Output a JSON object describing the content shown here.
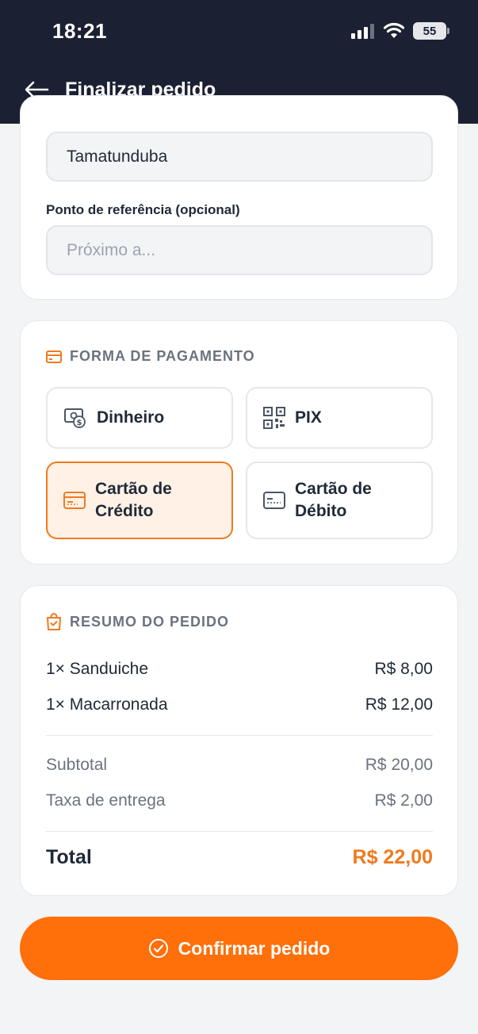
{
  "status_bar": {
    "time": "18:21",
    "battery": "55"
  },
  "header": {
    "title": "Finalizar pedido"
  },
  "address": {
    "neighborhood_value": "Tamatunduba",
    "reference_label": "Ponto de referência (opcional)",
    "reference_placeholder": "Próximo a..."
  },
  "payment": {
    "title": "FORMA DE PAGAMENTO",
    "options": [
      {
        "label": "Dinheiro",
        "icon": "cash-icon",
        "selected": false
      },
      {
        "label": "PIX",
        "icon": "qr-code-icon",
        "selected": false
      },
      {
        "label": "Cartão de Crédito",
        "line1": "Cartão de",
        "line2": "Crédito",
        "icon": "credit-card-icon",
        "selected": true
      },
      {
        "label": "Cartão de Débito",
        "line1": "Cartão de",
        "line2": "Débito",
        "icon": "debit-card-icon",
        "selected": false
      }
    ]
  },
  "summary": {
    "title": "RESUMO DO PEDIDO",
    "items": [
      {
        "name": "1× Sanduiche",
        "price": "R$ 8,00"
      },
      {
        "name": "1× Macarronada",
        "price": "R$ 12,00"
      }
    ],
    "subtotal_label": "Subtotal",
    "subtotal_value": "R$ 20,00",
    "delivery_label": "Taxa de entrega",
    "delivery_value": "R$ 2,00",
    "total_label": "Total",
    "total_value": "R$ 22,00"
  },
  "confirm_button": {
    "label": "Confirmar pedido"
  },
  "colors": {
    "header_bg": "#1b2132",
    "accent": "#ff6f0a",
    "accent_text": "#f07a1e",
    "selected_bg": "#fff1e6"
  }
}
